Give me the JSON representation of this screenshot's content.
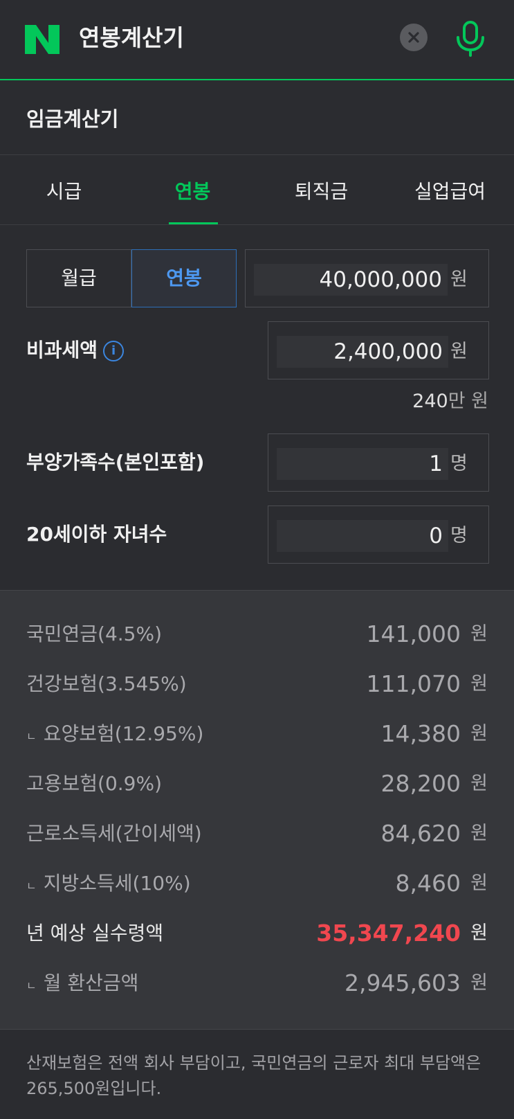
{
  "header": {
    "logo_letter": "N",
    "title": "연봉계산기",
    "clear_icon": "close-icon",
    "mic_icon": "microphone-icon",
    "accent": "#03c75a"
  },
  "section_title": "임금계산기",
  "tabs": [
    {
      "label": "시급",
      "active": false
    },
    {
      "label": "연봉",
      "active": true
    },
    {
      "label": "퇴직금",
      "active": false
    },
    {
      "label": "실업급여",
      "active": false
    }
  ],
  "form": {
    "pay_type": {
      "options": [
        "월급",
        "연봉"
      ],
      "selected": "연봉"
    },
    "salary": {
      "value": "40,000,000",
      "unit": "원"
    },
    "nontaxable": {
      "label": "비과세액",
      "info_icon": "info-icon",
      "value": "2,400,000",
      "unit": "원",
      "hint_number": "240",
      "hint_man": "만",
      "hint_unit": "원"
    },
    "dependents": {
      "label": "부양가족수(본인포함)",
      "value": "1",
      "unit": "명"
    },
    "children": {
      "label": "20세이하 자녀수",
      "value": "0",
      "unit": "명"
    }
  },
  "results": [
    {
      "label": "국민연금(4.5%)",
      "value": "141,000",
      "unit": "원",
      "sub": false
    },
    {
      "label": "건강보험(3.545%)",
      "value": "111,070",
      "unit": "원",
      "sub": false
    },
    {
      "label": "요양보험(12.95%)",
      "value": "14,380",
      "unit": "원",
      "sub": true
    },
    {
      "label": "고용보험(0.9%)",
      "value": "28,200",
      "unit": "원",
      "sub": false
    },
    {
      "label": "근로소득세(간이세액)",
      "value": "84,620",
      "unit": "원",
      "sub": false
    },
    {
      "label": "지방소득세(10%)",
      "value": "8,460",
      "unit": "원",
      "sub": true
    },
    {
      "label": "년 예상 실수령액",
      "value": "35,347,240",
      "unit": "원",
      "sub": false,
      "highlight": "#f0474f"
    },
    {
      "label": "월 환산금액",
      "value": "2,945,603",
      "unit": "원",
      "sub": true
    }
  ],
  "result_corner_glyph": "ㄴ",
  "notice": "산재보험은 전액 회사 부담이고, 국민연금의 근로자 최대 부담액은 265,500원입니다."
}
